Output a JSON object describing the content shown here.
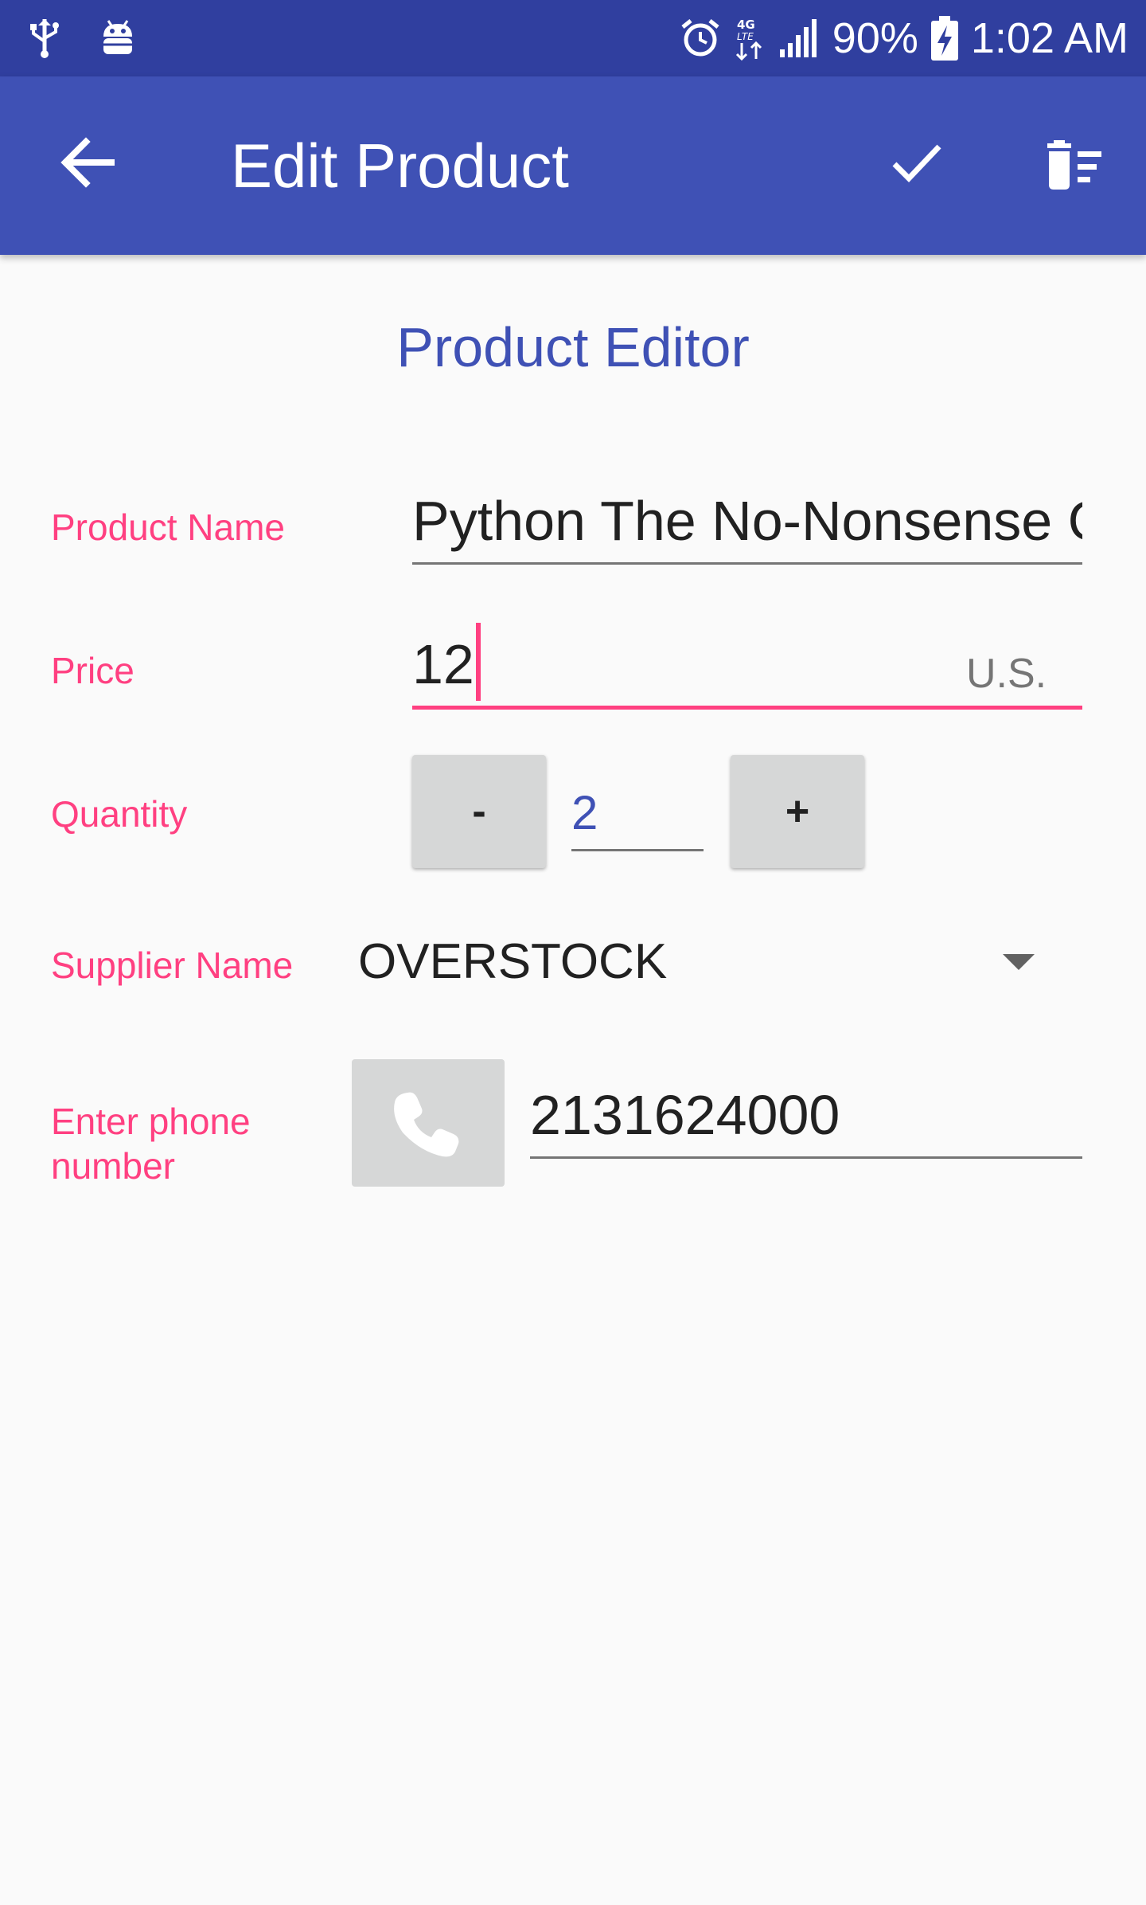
{
  "status_bar": {
    "icons_left": [
      "usb-icon",
      "android-debug-icon"
    ],
    "icons_right": [
      "alarm-icon",
      "4g-lte-icon",
      "signal-icon",
      "battery-charging-icon"
    ],
    "battery": "90%",
    "time": "1:02 AM"
  },
  "app_bar": {
    "title": "Edit Product",
    "back_icon": "arrow-back-icon",
    "save_icon": "check-icon",
    "delete_icon": "delete-sweep-icon"
  },
  "editor": {
    "title": "Product Editor",
    "product_name": {
      "label": "Product Name",
      "value": "Python The No-Nonsense Guide"
    },
    "price": {
      "label": "Price",
      "value": "12",
      "unit_hint": "U.S."
    },
    "quantity": {
      "label": "Quantity",
      "decrement_label": "-",
      "value": "2",
      "increment_label": "+"
    },
    "supplier": {
      "label": "Supplier Name",
      "selected": "OVERSTOCK"
    },
    "phone": {
      "label": "Enter phone number",
      "value": "2131624000",
      "icon": "phone-icon"
    }
  },
  "colors": {
    "status_bar": "#303f9f",
    "primary": "#3f51b5",
    "accent": "#ff4081",
    "background": "#fafafa"
  }
}
